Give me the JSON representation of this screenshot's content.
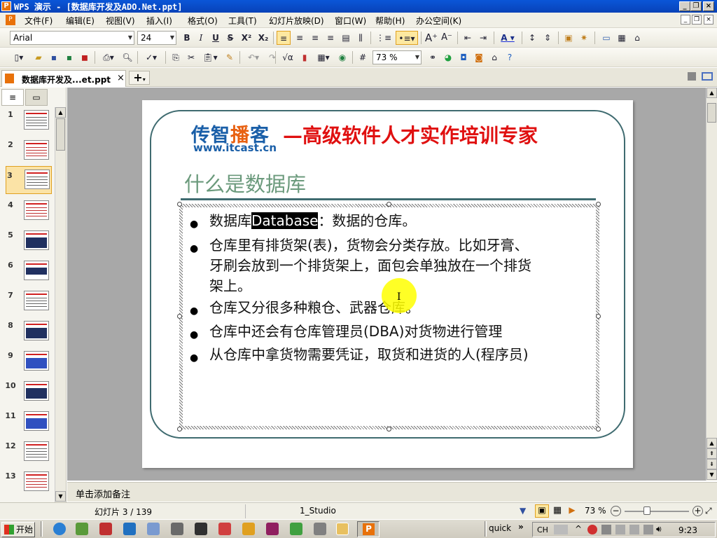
{
  "window": {
    "title": "WPS 演示 - [数据库开发及ADO.Net.ppt]",
    "app_icon": "P"
  },
  "menu": [
    "文件(F)",
    "编辑(E)",
    "视图(V)",
    "插入(I)",
    "格式(O)",
    "工具(T)",
    "幻灯片放映(D)",
    "窗口(W)",
    "帮助(H)",
    "办公空间(K)"
  ],
  "format_toolbar": {
    "font": "Arial",
    "size": "24",
    "bold": "B",
    "italic": "I",
    "underline": "U",
    "shadow": "S",
    "superscript": "X²",
    "subscript": "X₂",
    "font_color": "A"
  },
  "standard_toolbar": {
    "zoom": "73 %"
  },
  "tabs": {
    "doc_tab": "数据库开发及...et.ppt",
    "close": "×",
    "add": "+"
  },
  "thumbnails": [
    "1",
    "2",
    "3",
    "4",
    "5",
    "6",
    "7",
    "8",
    "9",
    "10",
    "11",
    "12",
    "13"
  ],
  "selected_slide": "3",
  "slide": {
    "logo_main": "传智播客",
    "logo_url": "www.itcast.cn",
    "slogan": "—高级软件人才实作培训专家",
    "title": "什么是数据库",
    "bullet_symbol": "●",
    "bullets": [
      {
        "pre": "数据库",
        "highlight": "Database",
        "post": "：数据的仓库。"
      },
      {
        "text": "仓库里有排货架(表)，货物会分类存放。比如牙膏、"
      },
      {
        "text": "牙刷会放到一个排货架上，面包会单独放在一个排货"
      },
      {
        "text": "架上。"
      },
      {
        "text": "仓库又分很多种粮仓、武器仓库。"
      },
      {
        "text": "仓库中还会有仓库管理员(DBA)对货物进行管理"
      },
      {
        "text": "从仓库中拿货物需要凭证，取货和进货的人(程序员)"
      }
    ]
  },
  "notes_placeholder": "单击添加备注",
  "status": {
    "slide_pos": "幻灯片 3 / 139",
    "template": "1_Studio",
    "zoom": "73 %"
  },
  "taskbar": {
    "start": "开始",
    "quick": "quick",
    "ime": "CH",
    "time": "9:23"
  }
}
